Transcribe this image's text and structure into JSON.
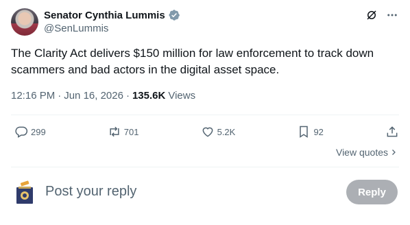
{
  "author": {
    "name": "Senator Cynthia Lummis",
    "handle": "@SenLummis",
    "verified_color": "#829aab"
  },
  "tweet": {
    "text": "The Clarity Act delivers $150 million for law enforcement to track down scammers and bad actors in the digital asset space.",
    "time": "12:16 PM",
    "date": "Jun 16, 2026",
    "views_count": "135.6K",
    "views_label": "Views"
  },
  "actions": {
    "replies": "299",
    "reposts": "701",
    "likes": "5.2K",
    "bookmarks": "92"
  },
  "view_quotes_label": "View quotes",
  "reply": {
    "placeholder": "Post your reply",
    "button_label": "Reply"
  },
  "icons": [
    "grok-icon",
    "more-icon",
    "reply-icon",
    "repost-icon",
    "like-icon",
    "bookmark-icon",
    "share-icon",
    "chevron-right-icon",
    "verified-badge-icon"
  ],
  "colors": {
    "text": "#0f1419",
    "secondary": "#536471",
    "divider": "#eff3f4",
    "reply_button": "#9ea2a7"
  }
}
